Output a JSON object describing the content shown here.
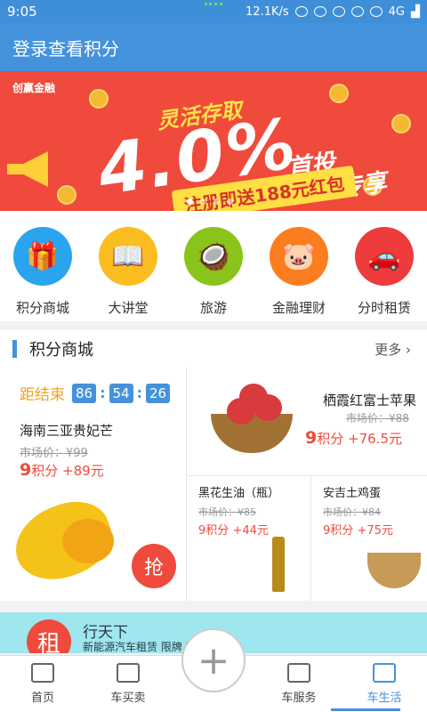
{
  "status": {
    "time": "9:05",
    "speed": "12.1K/s",
    "network": "4G"
  },
  "title": "登录查看积分",
  "banner": {
    "brand": "创赢金融",
    "tagline": "灵活存取",
    "rate": "4.0%",
    "bonus_line1": "首投",
    "bonus_line2": "加息专享",
    "register": "注册即送188元红包"
  },
  "categories": [
    {
      "label": "积分商城",
      "color": "#2aa4ee",
      "icon": "gift-icon"
    },
    {
      "label": "大讲堂",
      "color": "#fbbd1f",
      "icon": "book-icon"
    },
    {
      "label": "旅游",
      "color": "#8ac41a",
      "icon": "coconut-icon"
    },
    {
      "label": "金融理财",
      "color": "#fb7d1f",
      "icon": "piggy-bank-icon"
    },
    {
      "label": "分时租赁",
      "color": "#ee3b3b",
      "icon": "car-rental-icon"
    }
  ],
  "section": {
    "title": "积分商城",
    "more": "更多"
  },
  "countdown": {
    "label": "距结束",
    "h": "86",
    "m": "54",
    "s": "26"
  },
  "products": {
    "mango": {
      "name": "海南三亚贵妃芒",
      "market": "市场价：¥99",
      "points": "9",
      "points_unit": "积分",
      "plus": "+89元",
      "grab": "抢"
    },
    "apple": {
      "name": "栖霞红富士苹果",
      "market": "市场价：¥88",
      "points": "9",
      "points_unit": "积分",
      "plus": "+76.5元"
    },
    "oil": {
      "name": "黑花生油（瓶）",
      "market": "市场价：¥85",
      "points": "9",
      "points_unit": "积分",
      "plus": "+44元"
    },
    "eggs": {
      "name": "安吉土鸡蛋",
      "market": "市场价：¥84",
      "points": "9",
      "points_unit": "积分",
      "plus": "+75元"
    }
  },
  "promo": {
    "badge": "租",
    "title": "行天下",
    "sub": "新能源汽车租赁  限牌  犹如浮云"
  },
  "tabs": [
    {
      "label": "首页",
      "icon": "home-icon"
    },
    {
      "label": "车买卖",
      "icon": "car-icon"
    },
    {
      "label": "",
      "icon": "plus-icon"
    },
    {
      "label": "车服务",
      "icon": "bottle-icon"
    },
    {
      "label": "车生活",
      "icon": "cup-icon",
      "active": true
    }
  ]
}
